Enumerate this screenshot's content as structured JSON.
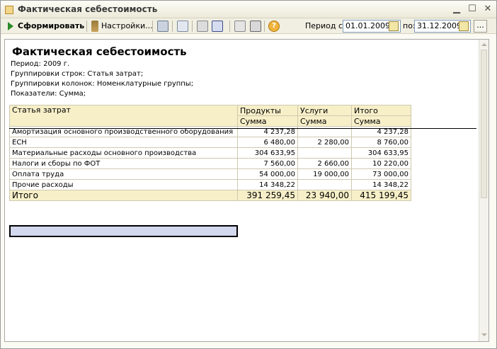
{
  "window": {
    "title": "Фактическая себестоимость"
  },
  "toolbar": {
    "generate_label": "Сформировать",
    "settings_label": "Настройки...",
    "period_from_label": "Период с:",
    "period_from_value": "01.01.2009",
    "period_to_label": "по:",
    "period_to_value": "31.12.2009",
    "more_label": "..."
  },
  "report": {
    "title": "Фактическая себестоимость",
    "period": "Период: 2009 г.",
    "row_groupings": "Группировки строк: Статья затрат;",
    "column_groupings": "Группировки колонок: Номенклатурные группы;",
    "indicators": "Показатели: Сумма;",
    "header": {
      "col1": "Статья затрат",
      "col2": "Продукты",
      "col3": "Услуги",
      "col4": "Итого",
      "sub2": "Сумма",
      "sub3": "Сумма",
      "sub4": "Сумма"
    },
    "rows": [
      {
        "name": "Амортизация основного производственного оборудования",
        "products": "4 237,28",
        "services": "",
        "total": "4 237,28"
      },
      {
        "name": "ЕСН",
        "products": "6 480,00",
        "services": "2 280,00",
        "total": "8 760,00"
      },
      {
        "name": "Материальные расходы основного производства",
        "products": "304 633,95",
        "services": "",
        "total": "304 633,95"
      },
      {
        "name": "Налоги и сборы по ФОТ",
        "products": "7 560,00",
        "services": "2 660,00",
        "total": "10 220,00"
      },
      {
        "name": "Оплата труда",
        "products": "54 000,00",
        "services": "19 000,00",
        "total": "73 000,00"
      },
      {
        "name": "Прочие расходы",
        "products": "14 348,22",
        "services": "",
        "total": "14 348,22"
      }
    ],
    "total_row": {
      "name": "Итого",
      "products": "391 259,45",
      "services": "23 940,00",
      "total": "415 199,45"
    }
  }
}
